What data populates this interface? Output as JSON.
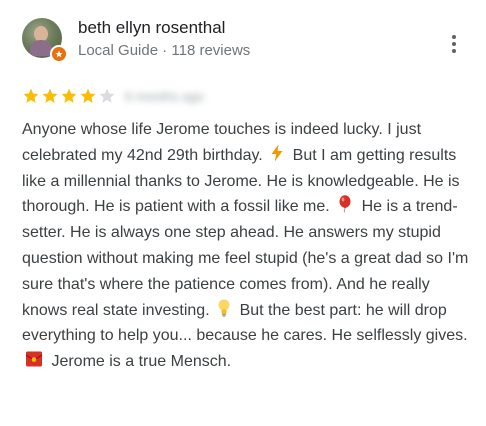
{
  "reviewer": {
    "name": "beth ellyn rosenthal",
    "meta": "Local Guide · 118 reviews",
    "badge_color": "#e8710a"
  },
  "rating": {
    "value": 4,
    "max": 5,
    "filled_color": "#fbbc04",
    "empty_color": "#dadce0",
    "date": "6 months ago"
  },
  "review": {
    "segments": [
      "Anyone whose life Jerome touches is indeed lucky.  I just celebrated my 42nd 29th birthday.",
      "But I am getting results like a millennial thanks to Jerome. He is knowledgeable. He is thorough. He is patient with a fossil like me.",
      "He is a trend-setter. He is always one step ahead. He answers my stupid question without making me feel stupid (he's a great dad so I'm sure that's where the patience comes from). And he really knows real state investing.",
      "But the best part: he will drop everything to help you... because he cares. He selflessly gives.",
      "Jerome is a true Mensch."
    ],
    "emojis": [
      "lightning-icon",
      "balloon-icon",
      "lightbulb-icon",
      "red-envelope-icon"
    ]
  },
  "menu": {
    "icon": "more-vert-icon"
  }
}
